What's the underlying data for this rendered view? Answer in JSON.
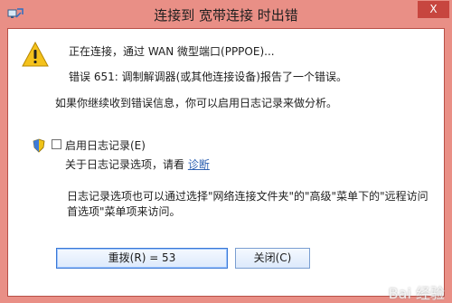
{
  "window": {
    "title": "连接到 宽带连接 时出错",
    "close_symbol": "X"
  },
  "messages": {
    "status": "正在连接，通过 WAN 微型端口(PPPOE)...",
    "error": "错误 651: 调制解调器(或其他连接设备)报告了一个错误。",
    "hint": "如果你继续收到错误信息，你可以启用日志记录来做分析。"
  },
  "logging": {
    "checkbox_label": "启用日志记录(E)",
    "options_text": "关于日志记录选项，请看",
    "diagnose_link": "诊断",
    "note_line1": "日志记录选项也可以通过选择\"网络连接文件夹\"的\"高级\"菜单下的\"远程访问",
    "note_line2": "首选项\"菜单项来访问。"
  },
  "buttons": {
    "redial": "重拨(R) = 53",
    "close": "关闭(C)"
  },
  "watermark": "Bai 经验"
}
